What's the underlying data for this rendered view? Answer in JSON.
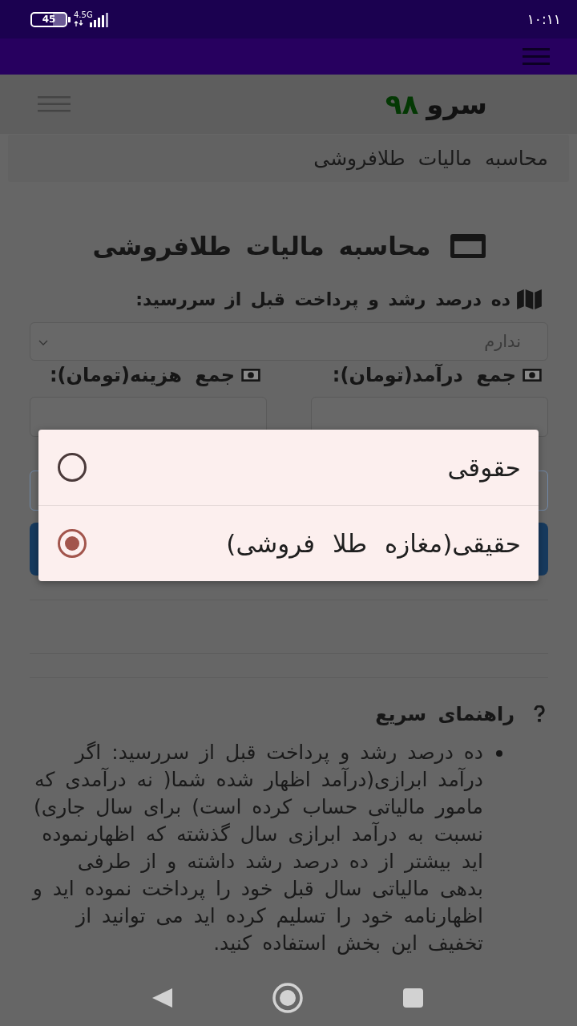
{
  "status_bar": {
    "time": "۱۰:۱۱",
    "battery": "45",
    "network": "4.5G"
  },
  "header": {
    "logo": {
      "name": "سرو",
      "number": "۹۸"
    }
  },
  "breadcrumb": {
    "current": "محاسبه مالیات طلافروشی"
  },
  "form": {
    "title": "محاسبه مالیات طلافروشی",
    "fields": [
      {
        "kind": "select",
        "label": "ده درصد رشد و پرداخت قبل از سررسید:",
        "value": "ندارم"
      },
      {
        "kind": "amount",
        "label": "جمع درآمد(تومان):"
      },
      {
        "kind": "amount",
        "label": "جمع هزینه(تومان):"
      }
    ]
  },
  "dialog": {
    "options": [
      {
        "label": "حقوقی",
        "selected": false
      },
      {
        "label": "حقیقی(مغازه طلا فروشی)",
        "selected": true
      }
    ]
  },
  "help": {
    "title": "راهنمای سریع",
    "items": [
      "ده درصد رشد و پرداخت قبل از سررسید: اگر درآمد ابرازی(درآمد اظهار شده شما( نه درآمدی که مامور مالیاتی حساب کرده است) برای سال جاری) نسبت به درآمد ابرازی سال گذشته که اظهارنموده اید بیشتر از ده درصد رشد داشته و از طرفی بدهی مالیاتی سال قبل خود را پرداخت نموده اید و اظهارنامه خود را تسلیم کرده اید می توانید از تخفیف این بخش استفاده کنید."
    ]
  }
}
